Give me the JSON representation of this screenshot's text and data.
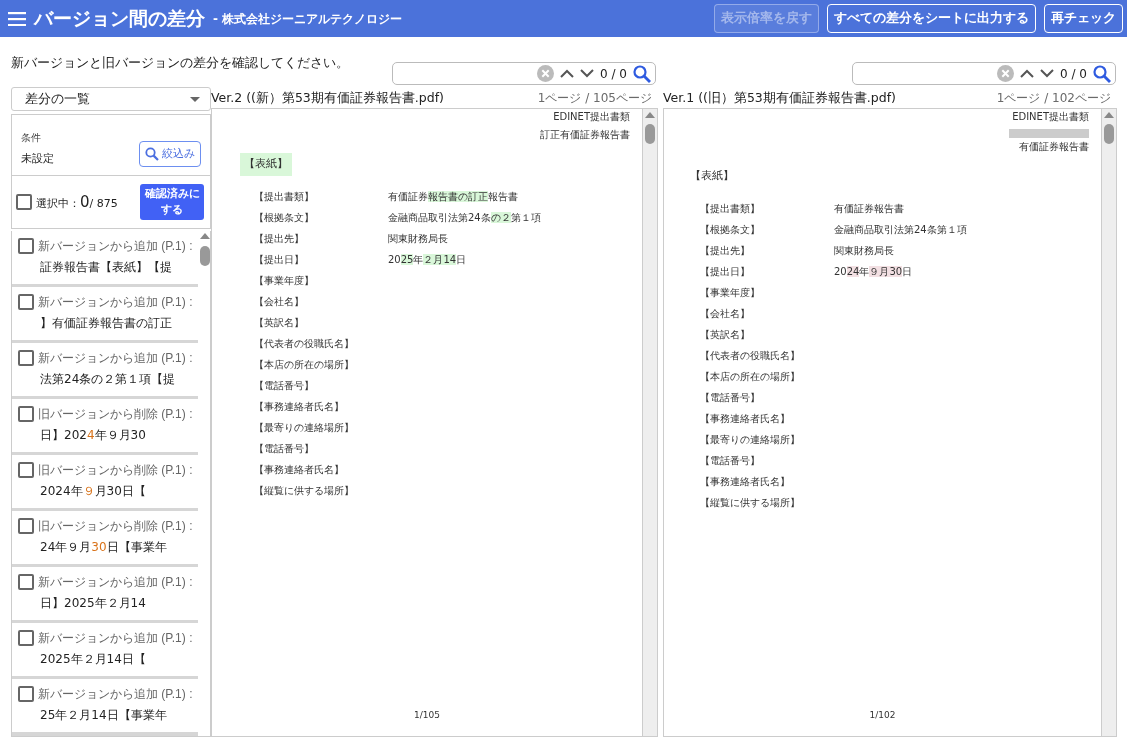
{
  "header": {
    "title": "バージョン間の差分",
    "subtitle": "- 株式会社ジーニアルテクノロジー",
    "buttons": [
      {
        "label": "表示倍率を戻す",
        "disabled": true
      },
      {
        "label": "すべての差分をシートに出力する",
        "disabled": false
      },
      {
        "label": "再チェック",
        "disabled": false
      }
    ]
  },
  "instruction": "新バージョンと旧バージョンの差分を確認してください。",
  "sidebar": {
    "dropdown": "差分の一覧",
    "filter": {
      "label": "条件",
      "value": "未設定",
      "button": "絞込み"
    },
    "selection": {
      "checked": false,
      "label": "選択中：",
      "count": "0",
      "total": "/ 875",
      "button": "確認済みにする"
    },
    "items": [
      {
        "title": "新バージョンから追加 (P.1) :",
        "checked": false,
        "snippet": [
          {
            "text": "証券報告書【表紙】【提",
            "changed": false
          }
        ]
      },
      {
        "title": "新バージョンから追加 (P.1) :",
        "checked": false,
        "snippet": [
          {
            "text": "】有価証券報告書の訂正",
            "changed": false
          }
        ]
      },
      {
        "title": "新バージョンから追加 (P.1) :",
        "checked": false,
        "snippet": [
          {
            "text": "法第24条の２第１項【提",
            "changed": false
          }
        ]
      },
      {
        "title": "旧バージョンから削除 (P.1) :",
        "checked": false,
        "snippet": [
          {
            "text": "日】202",
            "changed": false
          },
          {
            "text": "4",
            "changed": true
          },
          {
            "text": "年９月30",
            "changed": false
          }
        ]
      },
      {
        "title": "旧バージョンから削除 (P.1) :",
        "checked": false,
        "snippet": [
          {
            "text": "2024年",
            "changed": false
          },
          {
            "text": "９",
            "changed": true
          },
          {
            "text": "月30日【",
            "changed": false
          }
        ]
      },
      {
        "title": "旧バージョンから削除 (P.1) :",
        "checked": false,
        "snippet": [
          {
            "text": "24年９月",
            "changed": false
          },
          {
            "text": "30",
            "changed": true
          },
          {
            "text": "日【事業年",
            "changed": false
          }
        ]
      },
      {
        "title": "新バージョンから追加 (P.1) :",
        "checked": false,
        "snippet": [
          {
            "text": "日】2025年２月14",
            "changed": false
          }
        ]
      },
      {
        "title": "新バージョンから追加 (P.1) :",
        "checked": false,
        "snippet": [
          {
            "text": "2025年２月14日【",
            "changed": false
          }
        ]
      },
      {
        "title": "新バージョンから追加 (P.1) :",
        "checked": false,
        "snippet": [
          {
            "text": "25年２月14日【事業年",
            "changed": false
          }
        ]
      }
    ]
  },
  "documents": [
    {
      "kind": "new",
      "search": {
        "counter": "0 / 0"
      },
      "title": "Ver.2 ((新）第53期有価証券報告書.pdf)",
      "pages": "1ページ / 105ページ",
      "header_lines": [
        {
          "kind": "text",
          "text": "EDINET提出書類"
        },
        {
          "kind": "text",
          "text": "訂正有価証券報告書"
        }
      ],
      "heading": [
        {
          "text": "【表紙】",
          "changed": true
        }
      ],
      "rows": [
        {
          "label": "【提出書類】",
          "value": [
            {
              "text": "有価証券",
              "changed": false
            },
            {
              "text": "報告書の訂正",
              "changed": true
            },
            {
              "text": "報告書",
              "changed": false
            }
          ]
        },
        {
          "label": "【根拠条文】",
          "value": [
            {
              "text": "金融商品取引法第24条",
              "changed": false
            },
            {
              "text": "の２",
              "changed": true
            },
            {
              "text": "第１項",
              "changed": false
            }
          ]
        },
        {
          "label": "【提出先】",
          "value": [
            {
              "text": "関東財務局長",
              "changed": false
            }
          ]
        },
        {
          "label": "【提出日】",
          "value": [
            {
              "text": "20",
              "changed": false
            },
            {
              "text": "25",
              "changed": true
            },
            {
              "text": "年",
              "changed": false
            },
            {
              "text": "２月",
              "changed": true
            },
            {
              "text": "14",
              "changed": true
            },
            {
              "text": "日",
              "changed": false
            }
          ]
        },
        {
          "label": "【事業年度】"
        },
        {
          "label": "【会社名】"
        },
        {
          "label": "【英訳名】"
        },
        {
          "label": "【代表者の役職氏名】"
        },
        {
          "label": "【本店の所在の場所】"
        },
        {
          "label": "【電話番号】"
        },
        {
          "label": "【事務連絡者氏名】"
        },
        {
          "label": "【最寄りの連絡場所】"
        },
        {
          "label": "【電話番号】"
        },
        {
          "label": "【事務連絡者氏名】"
        },
        {
          "label": "【縦覧に供する場所】"
        }
      ],
      "page_number": "1/105"
    },
    {
      "kind": "old",
      "search": {
        "counter": "0 / 0"
      },
      "title": "Ver.1 ((旧）第53期有価証券報告書.pdf)",
      "pages": "1ページ / 102ページ",
      "header_lines": [
        {
          "kind": "text",
          "text": "EDINET提出書類"
        },
        {
          "kind": "removed"
        },
        {
          "kind": "text",
          "text": "有価証券報告書"
        }
      ],
      "heading": [
        {
          "text": "【表紙】",
          "changed": false
        }
      ],
      "rows": [
        {
          "label": "【提出書類】",
          "value": [
            {
              "text": "有価証券報告書",
              "changed": false
            }
          ]
        },
        {
          "label": "【根拠条文】",
          "value": [
            {
              "text": "金融商品取引法第24条第１項",
              "changed": false
            }
          ]
        },
        {
          "label": "【提出先】",
          "value": [
            {
              "text": "関東財務局長",
              "changed": false
            }
          ]
        },
        {
          "label": "【提出日】",
          "value": [
            {
              "text": "20",
              "changed": false
            },
            {
              "text": "24",
              "changed": true
            },
            {
              "text": "年",
              "changed": false
            },
            {
              "text": "９月",
              "changed": true
            },
            {
              "text": "30",
              "changed": true
            },
            {
              "text": "日",
              "changed": false
            }
          ]
        },
        {
          "label": "【事業年度】"
        },
        {
          "label": "【会社名】"
        },
        {
          "label": "【英訳名】"
        },
        {
          "label": "【代表者の役職氏名】"
        },
        {
          "label": "【本店の所在の場所】"
        },
        {
          "label": "【電話番号】"
        },
        {
          "label": "【事務連絡者氏名】"
        },
        {
          "label": "【最寄りの連絡場所】"
        },
        {
          "label": "【電話番号】"
        },
        {
          "label": "【事務連絡者氏名】"
        },
        {
          "label": "【縦覧に供する場所】"
        }
      ],
      "page_number": "1/102"
    }
  ]
}
